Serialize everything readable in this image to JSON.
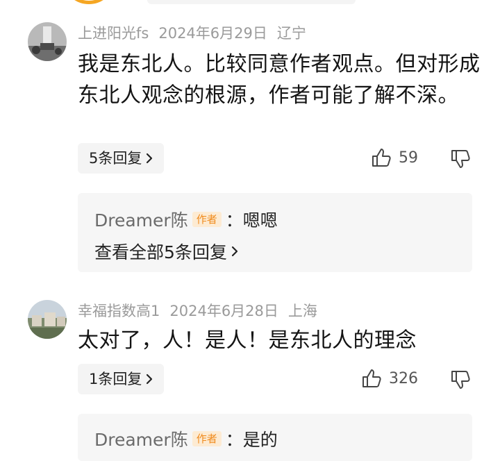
{
  "comments": [
    {
      "username": "上进阳光fs",
      "date": "2024年6月29日",
      "location": "辽宁",
      "text": "我是东北人。比较同意作者观点。但对形成东北人观念的根源，作者可能了解不深。",
      "reply_count_label": "5条回复",
      "likes": "59",
      "sub_reply": {
        "username": "Dreamer陈",
        "tag": "作者",
        "separator": "：",
        "text": "嗯嗯"
      },
      "view_all_label": "查看全部5条回复"
    },
    {
      "username": "幸福指数高1",
      "date": "2024年6月28日",
      "location": "上海",
      "text": "太对了，人！是人！是东北人的理念",
      "reply_count_label": "1条回复",
      "likes": "326",
      "sub_reply": {
        "username": "Dreamer陈",
        "tag": "作者",
        "separator": "：",
        "text": "是的"
      }
    }
  ],
  "icons": {
    "like": "thumb-up-icon",
    "dislike": "thumb-down-icon",
    "chevron": "chevron-right-icon"
  },
  "colors": {
    "meta_text": "#9a9a9a",
    "author_tag_bg": "#fdebd3",
    "author_tag_text": "#f08b1e",
    "panel_bg": "#f4f4f4"
  }
}
